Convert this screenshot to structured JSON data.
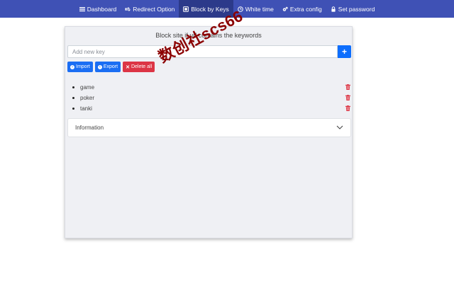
{
  "nav": {
    "items": [
      {
        "label": "Dashboard",
        "icon": "list-icon",
        "active": false
      },
      {
        "label": "Redirect Option",
        "icon": "redirect-icon",
        "active": false
      },
      {
        "label": "Block by Keys",
        "icon": "block-icon",
        "active": true
      },
      {
        "label": "White time",
        "icon": "clock-icon",
        "active": false
      },
      {
        "label": "Extra config",
        "icon": "gears-icon",
        "active": false
      },
      {
        "label": "Set password",
        "icon": "lock-icon",
        "active": false
      }
    ]
  },
  "main": {
    "title": "Block site if url contains the keywords",
    "input_placeholder": "Add new key",
    "add_symbol": "+",
    "buttons": {
      "import": "Import",
      "export": "Export",
      "delete_all": "Delete all"
    },
    "keys": [
      "game",
      "poker",
      "tanki"
    ],
    "accordion_label": "Information"
  },
  "watermark": {
    "text": "数创社scs66"
  },
  "colors": {
    "navbar": "#3f51b5",
    "active_tab": "#2c3a8a",
    "primary": "#1b6ef3",
    "danger": "#dc3545",
    "watermark": "#8b0000"
  }
}
